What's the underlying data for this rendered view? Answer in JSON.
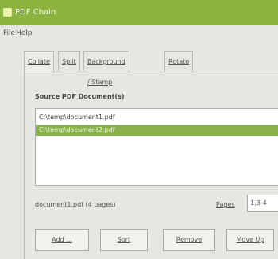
{
  "window": {
    "title": "PDF Chain"
  },
  "menu": [
    "File",
    "Help"
  ],
  "tabs": [
    "Collate",
    "Split",
    "Background / Stamp",
    "Rotate"
  ],
  "collate": {
    "source_label": "Source PDF Document(s)",
    "files": [
      {
        "path": "C:\\temp\\document1.pdf",
        "selected": false
      },
      {
        "path": "C:\\temp\\document2.pdf",
        "selected": true
      }
    ],
    "info": "document1.pdf  (4 pages)",
    "pages_label": "Pages",
    "pages_value": "1,3-4",
    "buttons": [
      "Add ...",
      "Sort",
      "Remove",
      "Move Up"
    ]
  },
  "colors": {
    "title_bar": "#8db33f",
    "selection": "#8bb14b"
  }
}
